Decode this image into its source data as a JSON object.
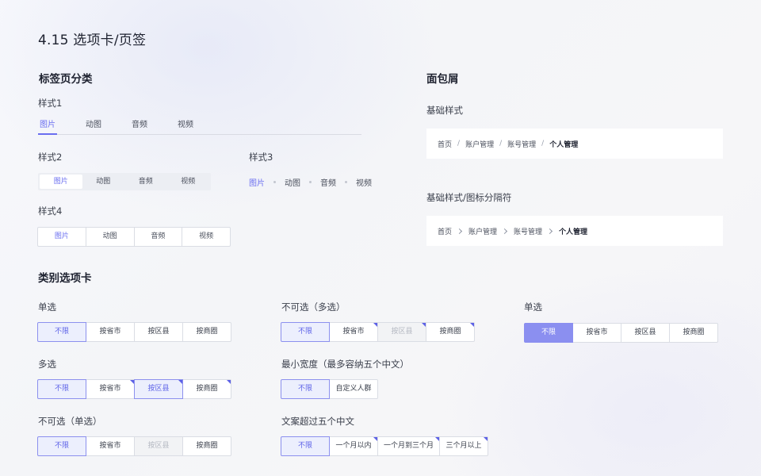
{
  "page_title": "4.15 选项卡/页签",
  "tabs_section": {
    "title": "标签页分类",
    "style1": {
      "label": "样式1",
      "items": [
        "图片",
        "动图",
        "音频",
        "视频"
      ]
    },
    "style2": {
      "label": "样式2",
      "items": [
        "图片",
        "动图",
        "音频",
        "视频"
      ]
    },
    "style3": {
      "label": "样式3",
      "items": [
        "图片",
        "动图",
        "音频",
        "视频"
      ]
    },
    "style4": {
      "label": "样式4",
      "items": [
        "图片",
        "动图",
        "音频",
        "视频"
      ]
    }
  },
  "breadcrumb_section": {
    "title": "面包屑",
    "basic": {
      "label": "基础样式",
      "items": [
        "首页",
        "账户管理",
        "账号管理",
        "个人管理"
      ],
      "separator": "/"
    },
    "icon": {
      "label": "基础样式/图标分隔符",
      "items": [
        "首页",
        "账户管理",
        "账号管理",
        "个人管理"
      ],
      "separator_icon": "chevron-right-icon"
    }
  },
  "category_section": {
    "title": "类别选项卡",
    "single": {
      "label": "单选",
      "items": [
        "不限",
        "按省市",
        "按区县",
        "按商圈"
      ]
    },
    "multi": {
      "label": "多选",
      "items": [
        "不限",
        "按省市",
        "按区县",
        "按商圈"
      ]
    },
    "disabled_single": {
      "label": "不可选（单选）",
      "items": [
        "不限",
        "按省市",
        "按区县",
        "按商圈"
      ]
    },
    "disabled_multi": {
      "label": "不可选（多选）",
      "items": [
        "不限",
        "按省市",
        "按区县",
        "按商圈"
      ]
    },
    "min_width": {
      "label": "最小宽度（最多容纳五个中文）",
      "items": [
        "不限",
        "自定义人群"
      ]
    },
    "overflow": {
      "label": "文案超过五个中文",
      "items": [
        "不限",
        "一个月以内",
        "一个月到三个月",
        "三个月以上"
      ]
    },
    "single_solid": {
      "label": "单选",
      "items": [
        "不限",
        "按省市",
        "按区县",
        "按商圈"
      ]
    }
  },
  "colors": {
    "accent": "#6a6ef0",
    "accent_solid": "#8b8ff0",
    "corner": "#5d61e6"
  }
}
